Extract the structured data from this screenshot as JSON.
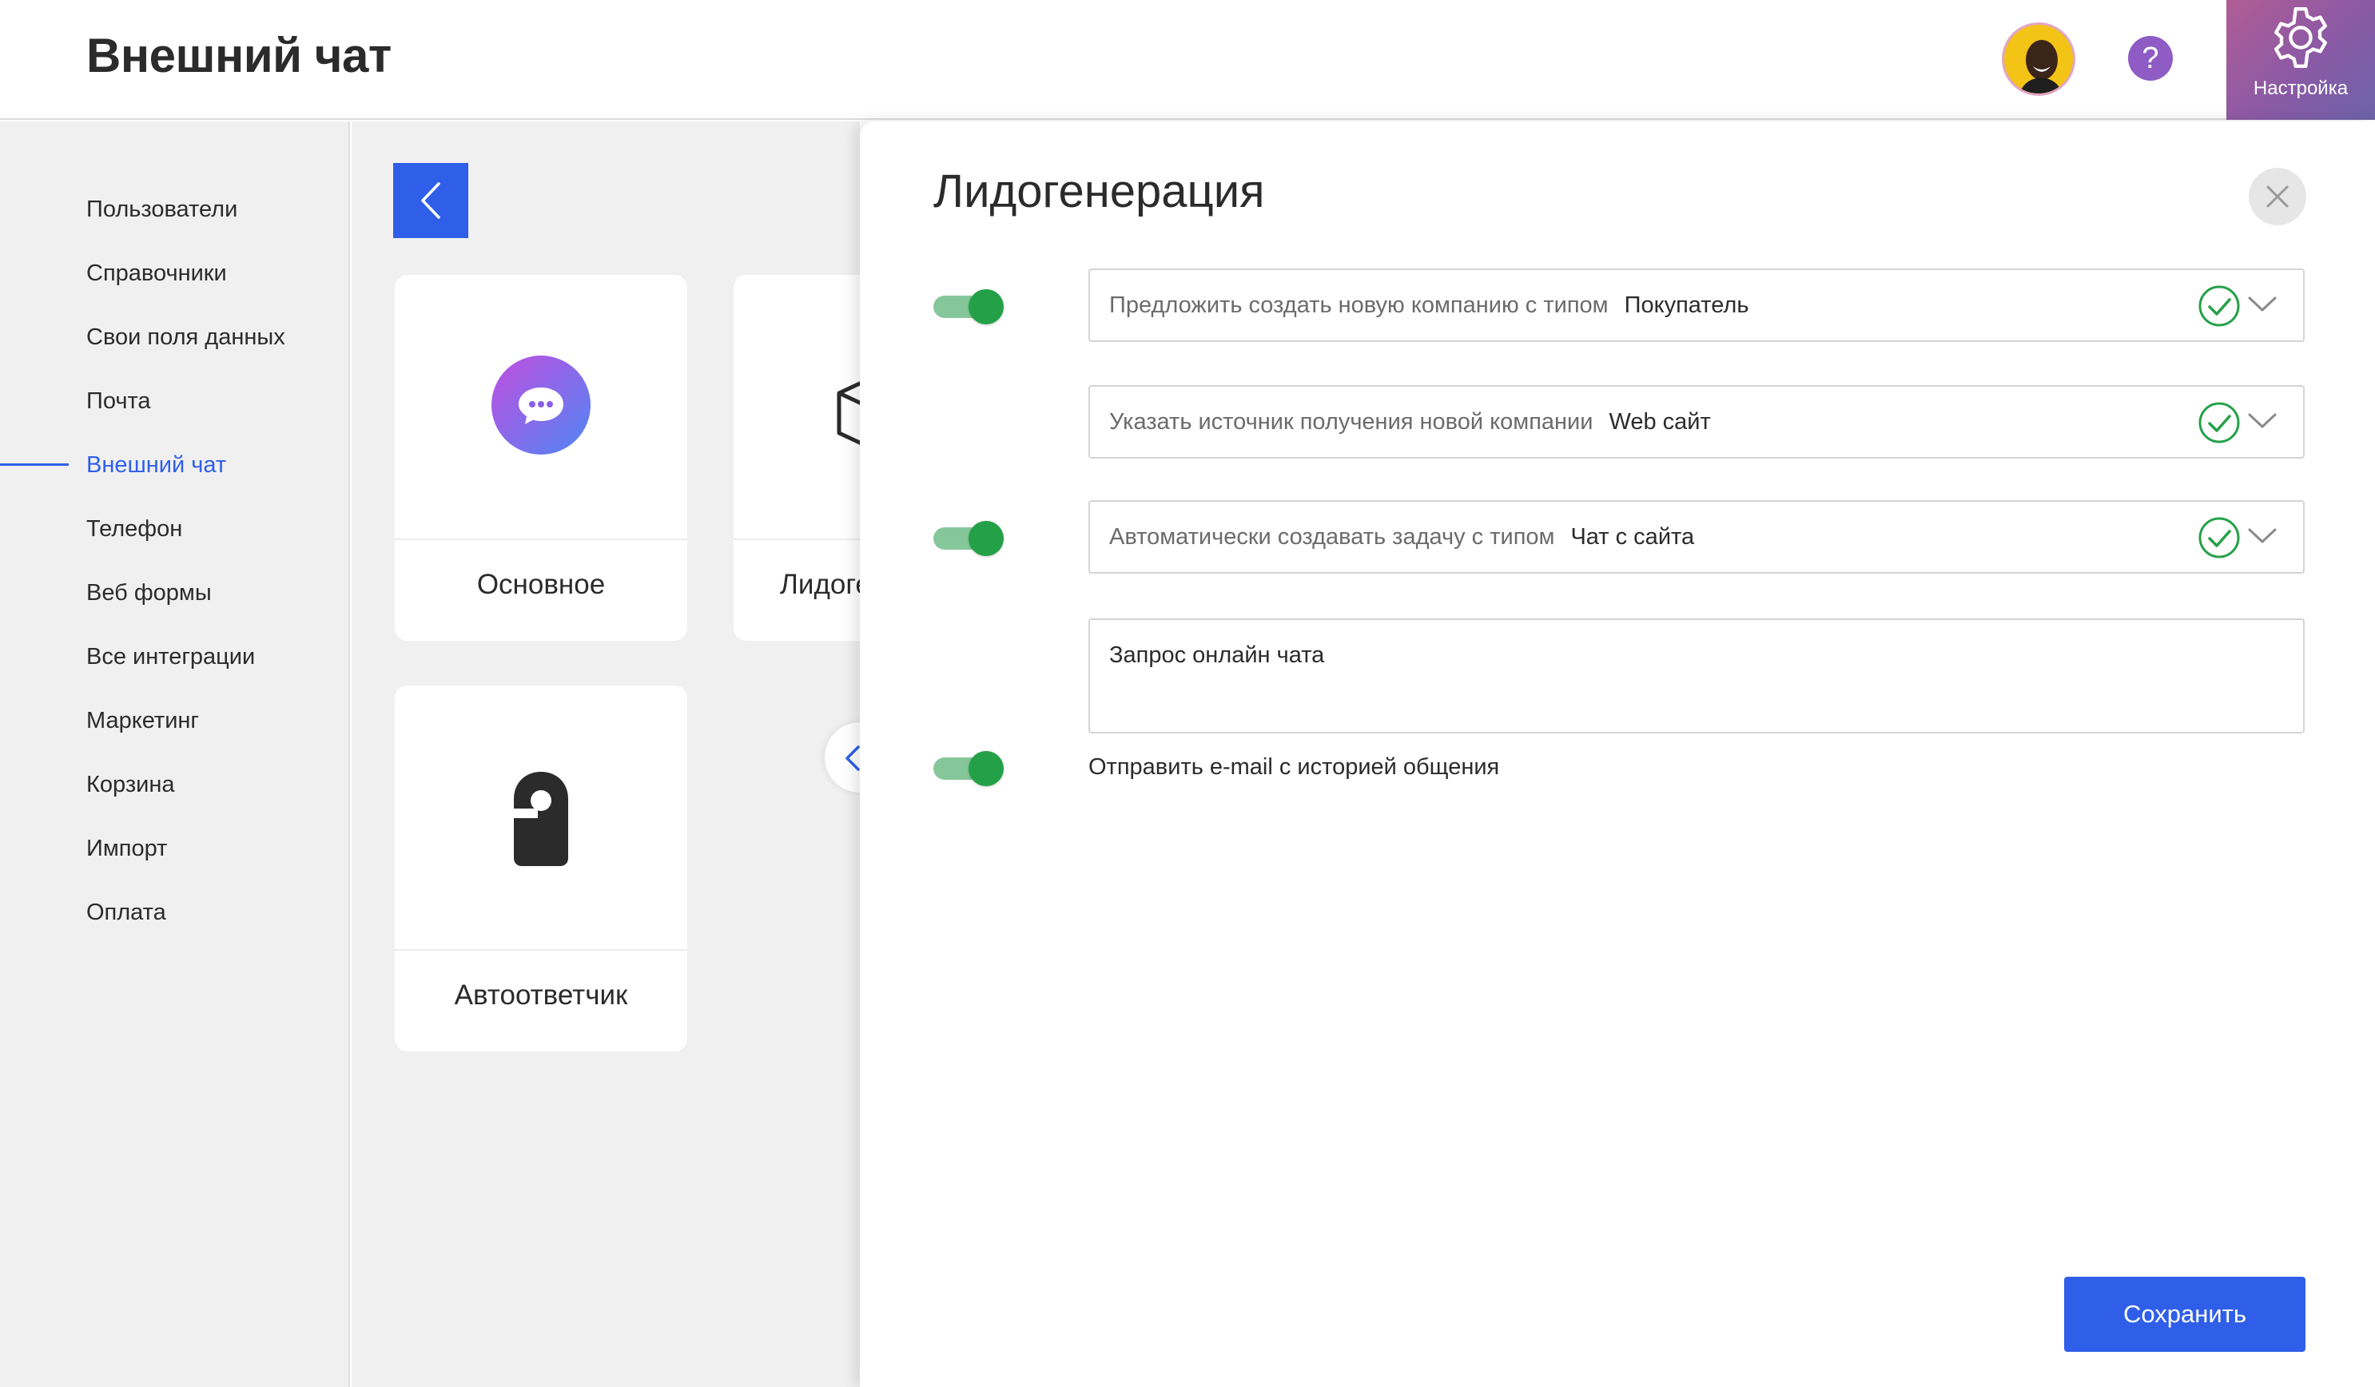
{
  "header": {
    "title": "Внешний чат",
    "help_label": "?",
    "settings_label": "Настройка"
  },
  "sidebar": {
    "items": [
      {
        "label": "Пользователи"
      },
      {
        "label": "Справочники"
      },
      {
        "label": "Свои поля данных"
      },
      {
        "label": "Почта"
      },
      {
        "label": "Внешний чат",
        "active": true
      },
      {
        "label": "Телефон"
      },
      {
        "label": "Веб формы"
      },
      {
        "label": "Все интеграции"
      },
      {
        "label": "Маркетинг"
      },
      {
        "label": "Корзина"
      },
      {
        "label": "Импорт"
      },
      {
        "label": "Оплата"
      }
    ]
  },
  "content": {
    "cards": [
      {
        "label": "Основное",
        "icon": "chat-bubble-icon"
      },
      {
        "label": "Лидогенерация",
        "icon": "box-icon"
      },
      {
        "label": "Автоответчик",
        "icon": "door-hanger-icon"
      }
    ]
  },
  "drawer": {
    "title": "Лидогенерация",
    "rows": [
      {
        "toggle_on": true,
        "label": "Предложить создать новую компанию с типом",
        "value": "Покупатель"
      },
      {
        "toggle_on": null,
        "label": "Указать источник получения новой компании",
        "value": "Web сайт"
      },
      {
        "toggle_on": true,
        "label": "Автоматически создавать задачу с типом",
        "value": "Чат с сайта"
      }
    ],
    "task_text": "Запрос онлайн чата",
    "email_toggle_on": true,
    "email_label": "Отправить e-mail с историей общения",
    "save_label": "Сохранить"
  },
  "colors": {
    "accent": "#2f5fe8",
    "toggle_on": "#24a148",
    "settings_gradient_start": "#b15c95",
    "settings_gradient_end": "#6d63a8",
    "help": "#8e5cc4"
  }
}
